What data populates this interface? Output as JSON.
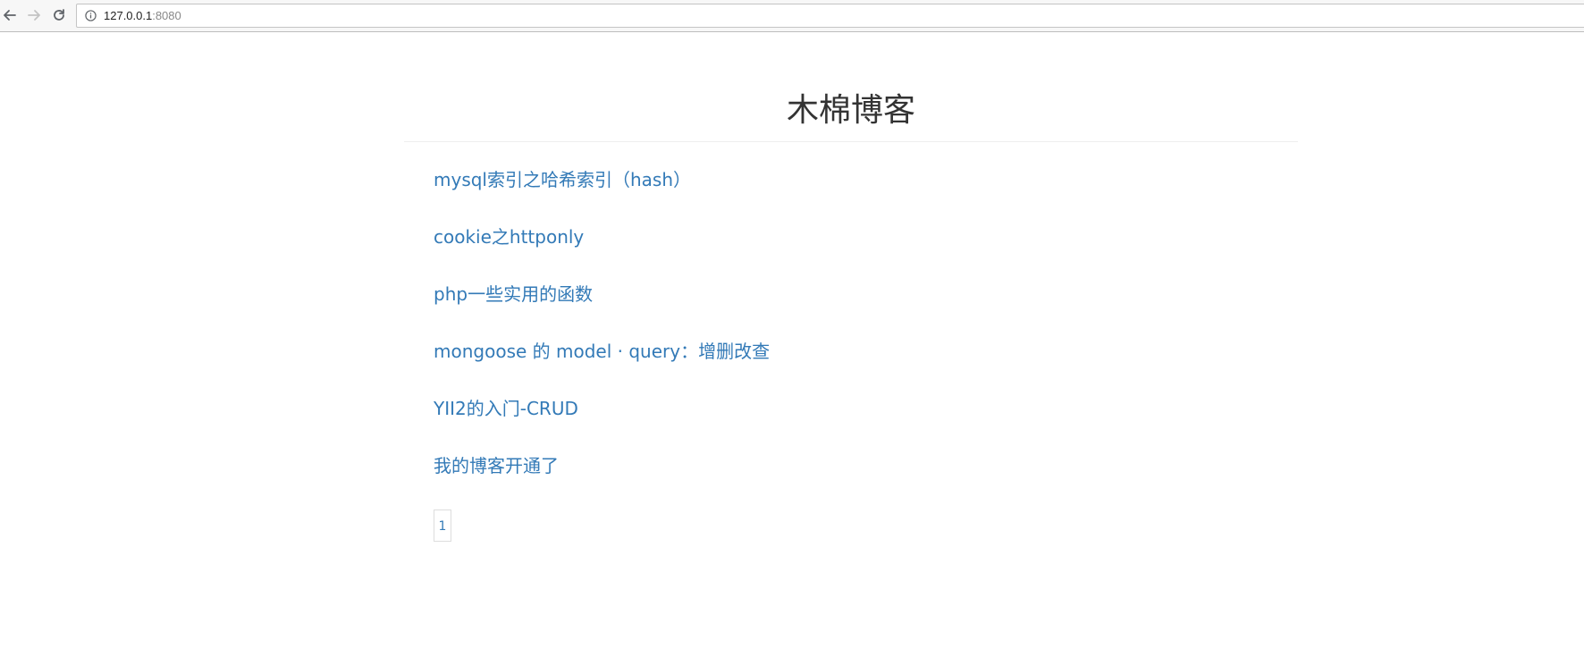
{
  "browser": {
    "url_host": "127.0.0.1",
    "url_port": ":8080"
  },
  "page": {
    "title": "木棉博客"
  },
  "posts": [
    {
      "label": "mysql索引之哈希索引（hash）"
    },
    {
      "label": "cookie之httponly"
    },
    {
      "label": "php一些实用的函数"
    },
    {
      "label": "mongoose 的 model · query：增删改查"
    },
    {
      "label": "YII2的入门-CRUD"
    },
    {
      "label": "我的博客开通了"
    }
  ],
  "pagination": {
    "pages": [
      "1"
    ]
  },
  "colors": {
    "link": "#337ab7",
    "title": "#333333"
  }
}
